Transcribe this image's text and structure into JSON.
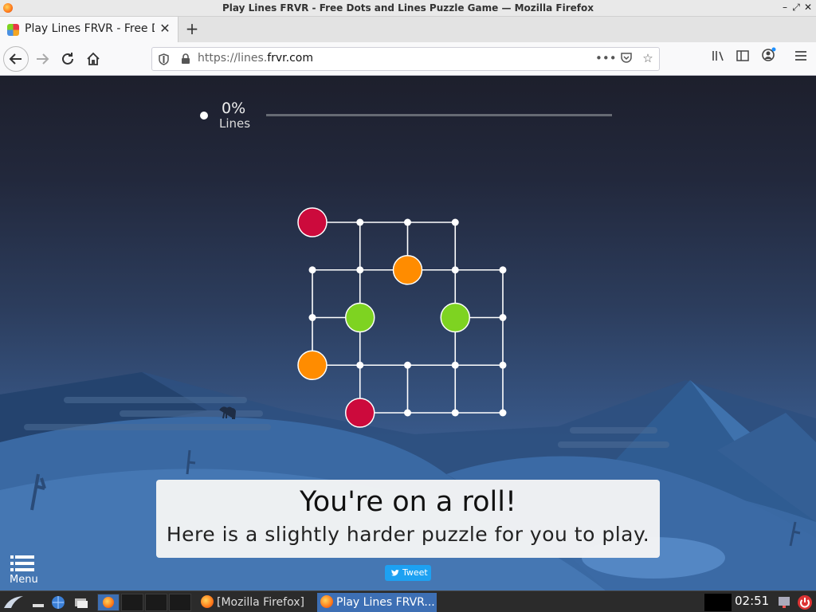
{
  "window": {
    "title": "Play Lines FRVR - Free Dots and Lines Puzzle Game — Mozilla Firefox"
  },
  "tabs": [
    {
      "label": "Play Lines FRVR - Free Dots and Lines Puzzle Game",
      "active": true
    }
  ],
  "browser": {
    "url_prefix": "https://lines.",
    "url_domain": "frvr.com"
  },
  "game": {
    "progress_value": "0%",
    "progress_label": "Lines",
    "progress_fraction": 0,
    "message_title": "You're on a roll!",
    "message_body": "Here is a slightly harder puzzle for you to play.",
    "tweet_label": "Tweet",
    "menu_label": "Menu",
    "colors": {
      "red": "#cc0a3c",
      "orange": "#ff8c00",
      "green": "#7ed321",
      "line": "#ffffff"
    },
    "board": {
      "cols": 5,
      "rows": 5,
      "colored_dots": [
        {
          "col": 0,
          "row": 0,
          "color": "red"
        },
        {
          "col": 2,
          "row": 1,
          "color": "orange"
        },
        {
          "col": 1,
          "row": 2,
          "color": "green"
        },
        {
          "col": 3,
          "row": 2,
          "color": "green"
        },
        {
          "col": 0,
          "row": 3,
          "color": "orange"
        },
        {
          "col": 1,
          "row": 4,
          "color": "red"
        }
      ],
      "empty_nodes": [
        [
          1,
          0
        ],
        [
          2,
          0
        ],
        [
          3,
          0
        ],
        [
          0,
          1
        ],
        [
          1,
          1
        ],
        [
          3,
          1
        ],
        [
          4,
          1
        ],
        [
          0,
          2
        ],
        [
          4,
          2
        ],
        [
          1,
          3
        ],
        [
          2,
          3
        ],
        [
          3,
          3
        ],
        [
          4,
          3
        ],
        [
          2,
          4
        ],
        [
          3,
          4
        ],
        [
          4,
          4
        ]
      ],
      "edges": [
        [
          [
            0,
            0
          ],
          [
            3,
            0
          ]
        ],
        [
          [
            0,
            1
          ],
          [
            4,
            1
          ]
        ],
        [
          [
            0,
            2
          ],
          [
            1,
            2
          ]
        ],
        [
          [
            3,
            2
          ],
          [
            4,
            2
          ]
        ],
        [
          [
            0,
            3
          ],
          [
            4,
            3
          ]
        ],
        [
          [
            1,
            4
          ],
          [
            4,
            4
          ]
        ],
        [
          [
            0,
            1
          ],
          [
            0,
            3
          ]
        ],
        [
          [
            1,
            0
          ],
          [
            1,
            4
          ]
        ],
        [
          [
            2,
            0
          ],
          [
            2,
            1
          ]
        ],
        [
          [
            2,
            3
          ],
          [
            2,
            4
          ]
        ],
        [
          [
            3,
            0
          ],
          [
            3,
            4
          ]
        ],
        [
          [
            4,
            1
          ],
          [
            4,
            4
          ]
        ]
      ]
    }
  },
  "taskbar": {
    "tasks": [
      {
        "label": "[Mozilla Firefox]",
        "active": false
      },
      {
        "label": "Play Lines FRVR...",
        "active": true
      }
    ],
    "clock": "02:51"
  }
}
